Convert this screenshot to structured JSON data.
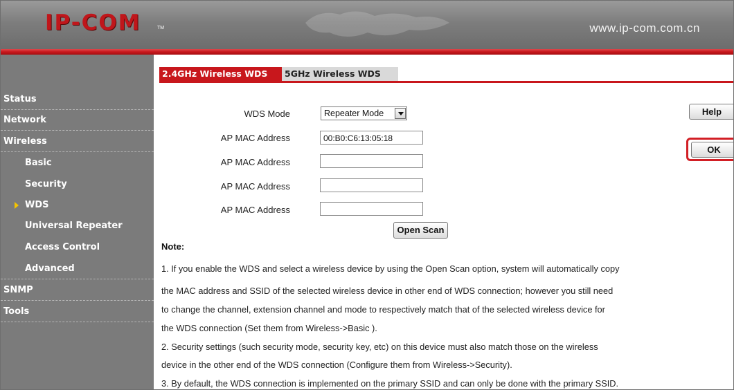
{
  "header": {
    "logo": "IP-COM",
    "logo_tm": "TM",
    "url": "www.ip-com.com.cn"
  },
  "sidebar": {
    "items": [
      {
        "label": "Status",
        "level": "top"
      },
      {
        "label": "Network",
        "level": "top"
      },
      {
        "label": "Wireless",
        "level": "top"
      },
      {
        "label": "Basic",
        "level": "sub"
      },
      {
        "label": "Security",
        "level": "sub"
      },
      {
        "label": "WDS",
        "level": "sub",
        "active": true
      },
      {
        "label": "Universal Repeater",
        "level": "sub"
      },
      {
        "label": "Access Control",
        "level": "sub"
      },
      {
        "label": "Advanced",
        "level": "sub"
      },
      {
        "label": "SNMP",
        "level": "top"
      },
      {
        "label": "Tools",
        "level": "top"
      }
    ]
  },
  "tabs": [
    {
      "label": "2.4GHz Wireless WDS",
      "active": true
    },
    {
      "label": "5GHz Wireless WDS",
      "active": false
    }
  ],
  "form": {
    "wds_mode_label": "WDS Mode",
    "wds_mode_value": "Repeater Mode",
    "ap_mac_label": "AP MAC Address",
    "ap_mac_values": [
      "00:B0:C6:13:05:18",
      "",
      "",
      ""
    ]
  },
  "buttons": {
    "open_scan": "Open Scan",
    "help": "Help",
    "ok": "OK"
  },
  "note": {
    "title": "Note:",
    "lines": [
      "1. If you enable the WDS and select a wireless device by using the Open Scan option, system will automatically copy",
      "the MAC address and SSID of the selected wireless device in other end of WDS connection; however you still need",
      "to change the channel, extension channel and mode to respectively match that of the selected wireless device for",
      "the WDS connection (Set them from Wireless->Basic ).",
      "2. Security settings (such security mode, security key, etc) on this device must also match those on the wireless",
      "device in the other end of the WDS connection (Configure them from Wireless->Security).",
      "3. By default, the WDS connection is implemented on the primary SSID and can only be done with the primary SSID."
    ]
  },
  "colors": {
    "accent_red": "#c8171c",
    "sidebar_bg": "#7b7b7b",
    "active_arrow": "#f5c400"
  }
}
